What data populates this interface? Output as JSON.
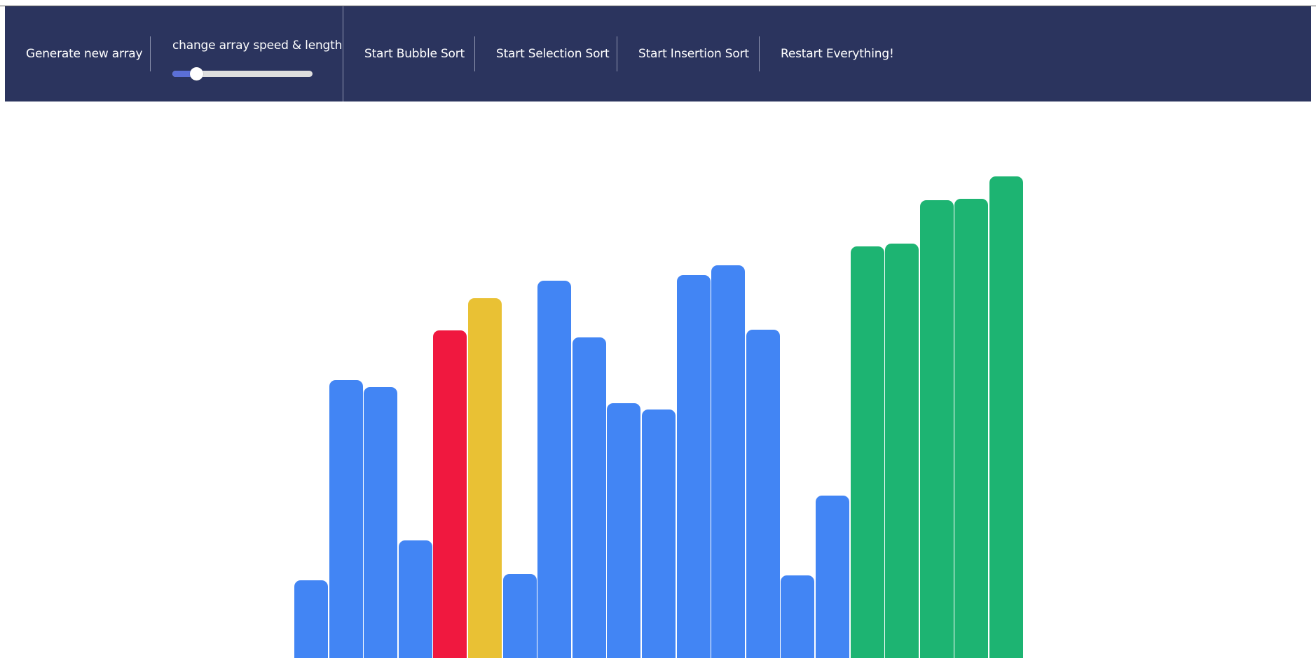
{
  "toolbar": {
    "generate_label": "Generate new array",
    "slider_label": "change array speed & length",
    "slider_value": 0.17,
    "bubble_label": "Start Bubble Sort",
    "selection_label": "Start Selection Sort",
    "insertion_label": "Start Insertion Sort",
    "restart_label": "Restart Everything!"
  },
  "colors": {
    "navbar": "#2b345e",
    "unsorted": "#4285f4",
    "comparing": "#f0183f",
    "swapping": "#e9c134",
    "sorted": "#1db472"
  },
  "bars": [
    {
      "value": 111,
      "state": "unsorted"
    },
    {
      "value": 397,
      "state": "unsorted"
    },
    {
      "value": 387,
      "state": "unsorted"
    },
    {
      "value": 168,
      "state": "unsorted"
    },
    {
      "value": 468,
      "state": "comparing"
    },
    {
      "value": 514,
      "state": "swapping"
    },
    {
      "value": 120,
      "state": "unsorted"
    },
    {
      "value": 539,
      "state": "unsorted"
    },
    {
      "value": 458,
      "state": "unsorted"
    },
    {
      "value": 364,
      "state": "unsorted"
    },
    {
      "value": 355,
      "state": "unsorted"
    },
    {
      "value": 547,
      "state": "unsorted"
    },
    {
      "value": 561,
      "state": "unsorted"
    },
    {
      "value": 469,
      "state": "unsorted"
    },
    {
      "value": 118,
      "state": "unsorted"
    },
    {
      "value": 232,
      "state": "unsorted"
    },
    {
      "value": 588,
      "state": "sorted"
    },
    {
      "value": 592,
      "state": "sorted"
    },
    {
      "value": 654,
      "state": "sorted"
    },
    {
      "value": 656,
      "state": "sorted"
    },
    {
      "value": 688,
      "state": "sorted"
    }
  ]
}
